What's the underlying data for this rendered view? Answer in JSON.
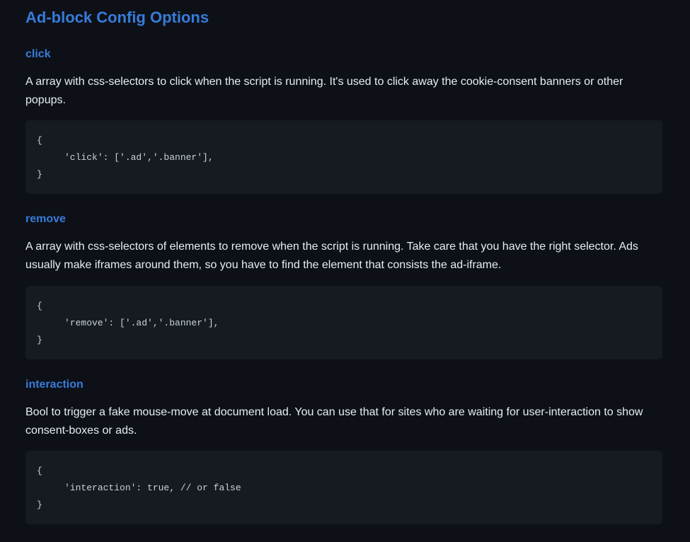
{
  "page": {
    "title": "Ad-block Config Options",
    "sections": [
      {
        "heading": "click",
        "description": "A array with css-selectors to click when the script is running. It's used to click away the cookie-consent banners or other popups.",
        "code": "{\n     'click': ['.ad','.banner'],\n}"
      },
      {
        "heading": "remove",
        "description": "A array with css-selectors of elements to remove when the script is running. Take care that you have the right selector. Ads usually make iframes around them, so you have to find the element that consists the ad-iframe.",
        "code": "{\n     'remove': ['.ad','.banner'],\n}"
      },
      {
        "heading": "interaction",
        "description": "Bool to trigger a fake mouse-move at document load. You can use that for sites who are waiting for user-interaction to show consent-boxes or ads.",
        "code": "{\n     'interaction': true, // or false\n}"
      }
    ]
  }
}
